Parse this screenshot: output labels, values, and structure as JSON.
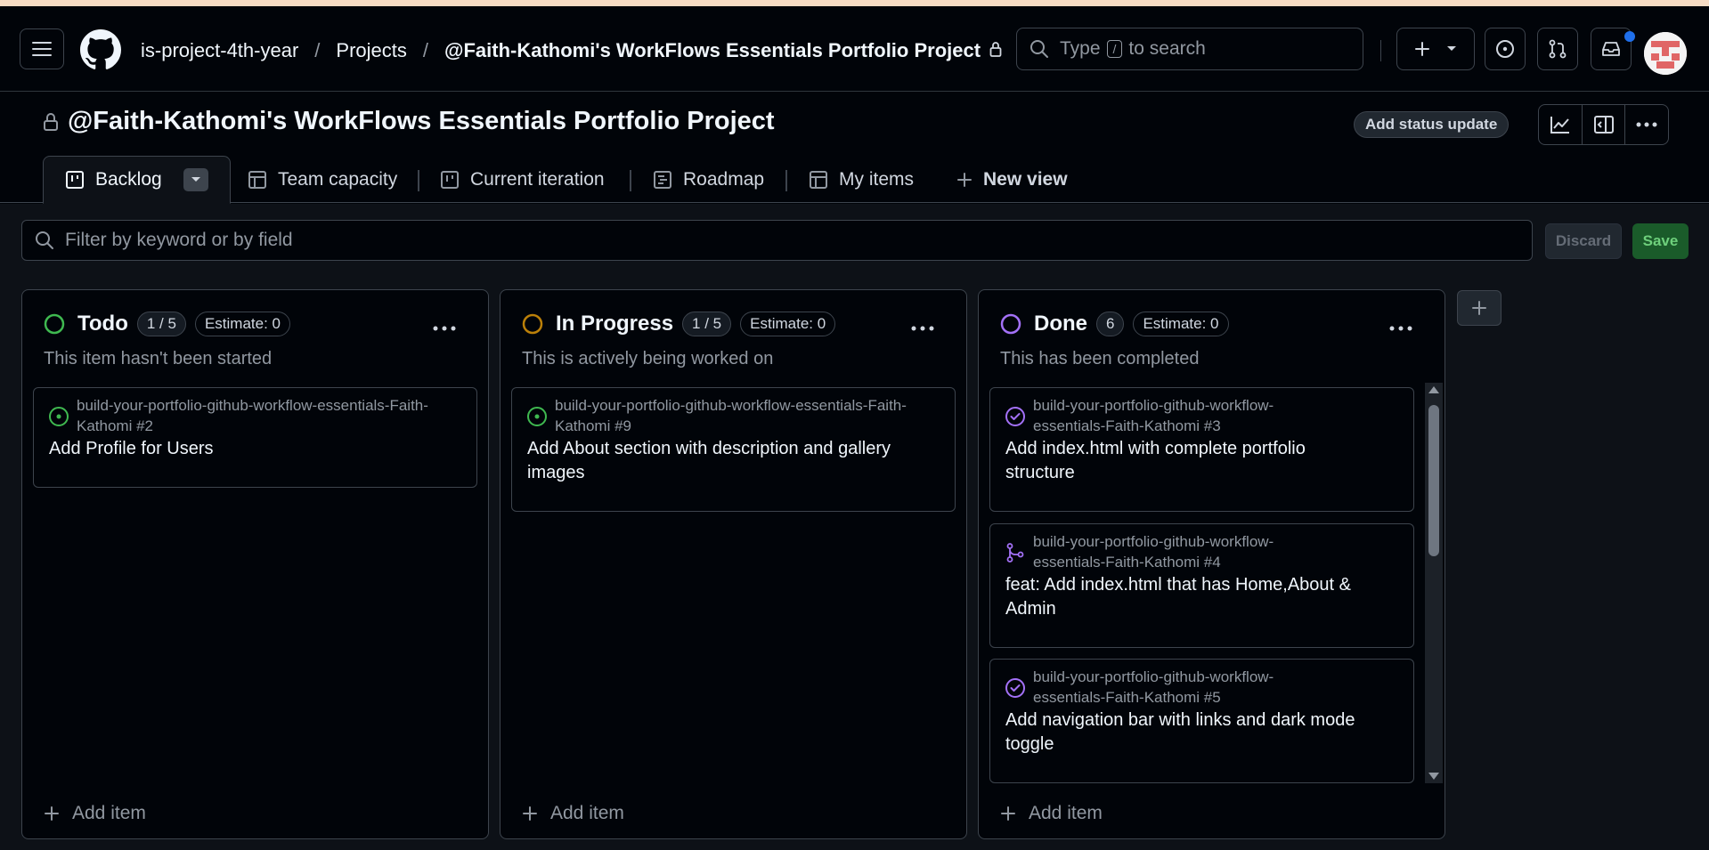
{
  "breadcrumbs": {
    "org": "is-project-4th-year",
    "projects": "Projects",
    "project": "@Faith-Kathomi's WorkFlows Essentials Portfolio Project"
  },
  "search": {
    "prefix": "Type",
    "key": "/",
    "suffix": "to search"
  },
  "project_title": "@Faith-Kathomi's WorkFlows Essentials Portfolio Project",
  "status_update_label": "Add status update",
  "tabs": [
    {
      "label": "Backlog"
    },
    {
      "label": "Team capacity"
    },
    {
      "label": "Current iteration"
    },
    {
      "label": "Roadmap"
    },
    {
      "label": "My items"
    },
    {
      "label": "New view"
    }
  ],
  "filter": {
    "placeholder": "Filter by keyword or by field",
    "discard_label": "Discard",
    "save_label": "Save"
  },
  "columns": [
    {
      "name": "Todo",
      "count": "1 / 5",
      "estimate": "Estimate: 0",
      "description": "This item hasn't been started",
      "status_color": "#3fb950",
      "add_label": "Add item",
      "cards": [
        {
          "repo": "build-your-portfolio-github-workflow-essentials-Faith-Kathomi #2",
          "title": "Add Profile for Users",
          "icon": "open-issue-icon"
        }
      ]
    },
    {
      "name": "In Progress",
      "count": "1 / 5",
      "estimate": "Estimate: 0",
      "description": "This is actively being worked on",
      "status_color": "#bb8009",
      "add_label": "Add item",
      "cards": [
        {
          "repo": "build-your-portfolio-github-workflow-essentials-Faith-Kathomi #9",
          "title": "Add About section with description and gallery images",
          "icon": "open-issue-icon"
        }
      ]
    },
    {
      "name": "Done",
      "count": "6",
      "estimate": "Estimate: 0",
      "description": "This has been completed",
      "status_color": "#a371f7",
      "add_label": "Add item",
      "cards": [
        {
          "repo_line1": "build-your-portfolio-github-workflow-",
          "repo_line2": "essentials-Faith-Kathomi #3",
          "title": "Add index.html with complete portfolio structure",
          "icon": "closed-issue-icon"
        },
        {
          "repo_line1": "build-your-portfolio-github-workflow-",
          "repo_line2": "essentials-Faith-Kathomi #4",
          "title": "feat: Add index.html that has Home,About & Admin",
          "icon": "merged-pr-icon"
        },
        {
          "repo_line1": "build-your-portfolio-github-workflow-",
          "repo_line2": "essentials-Faith-Kathomi #5",
          "title": "Add navigation bar with links and dark mode toggle",
          "icon": "closed-issue-icon"
        }
      ]
    }
  ]
}
